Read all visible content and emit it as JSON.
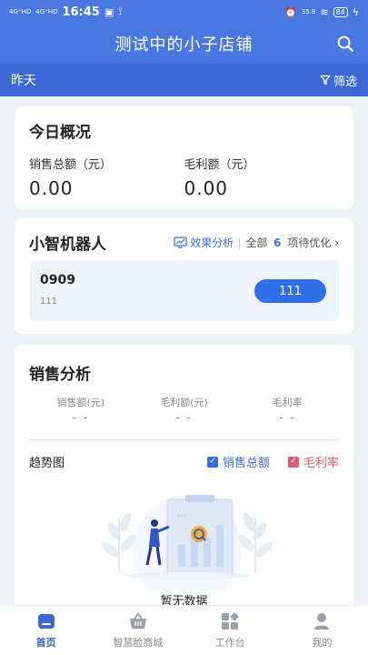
{
  "status_bar": {
    "signal1": "4G⁺HD",
    "signal2": "4G⁺HD",
    "time": "16:45",
    "speed": "35.8",
    "battery": "84"
  },
  "header": {
    "title": "测试中的小子店铺"
  },
  "date_bar": {
    "date": "昨天",
    "filter_label": "筛选"
  },
  "overview": {
    "title": "今日概况",
    "items": [
      {
        "label": "销售总额（元）",
        "value": "0.00"
      },
      {
        "label": "毛利额（元）",
        "value": "0.00"
      }
    ]
  },
  "robot": {
    "title": "小智机器人",
    "effect_label": "效果分析",
    "all_label": "全部",
    "pending_count": "6",
    "pending_label": "项待优化",
    "chevron": "›",
    "row": {
      "title": "0909",
      "subtitle": "111",
      "button_label": "111"
    }
  },
  "sales": {
    "title": "销售分析",
    "stats": [
      {
        "label": "销售额(元)",
        "value": "- -"
      },
      {
        "label": "毛利额(元)",
        "value": "- -"
      },
      {
        "label": "毛利率",
        "value": "- -"
      }
    ],
    "trend_label": "趋势图",
    "legend": [
      {
        "label": "销售总额",
        "color": "#3b6ddc"
      },
      {
        "label": "毛利率",
        "color": "#e05a72"
      }
    ],
    "empty_text": "暂无数据"
  },
  "tabs": [
    {
      "label": "首页",
      "icon": "home-icon",
      "active": true
    },
    {
      "label": "智慧脸商城",
      "icon": "basket-icon",
      "active": false
    },
    {
      "label": "工作台",
      "icon": "grid-icon",
      "active": false
    },
    {
      "label": "我的",
      "icon": "user-icon",
      "active": false
    }
  ],
  "colors": {
    "primary": "#4a78e3",
    "date_bar": "#3c68d6",
    "button": "#2f6fe8"
  }
}
